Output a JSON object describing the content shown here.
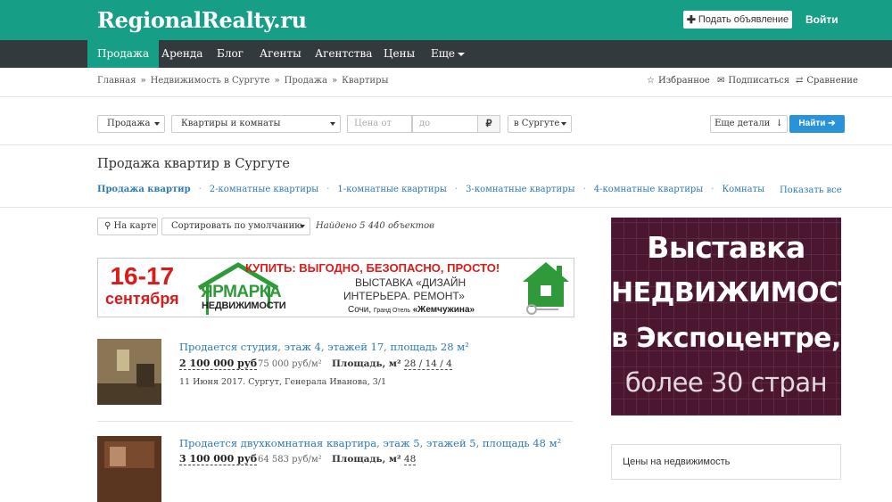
{
  "header": {
    "logo": "RegionalRealty.ru",
    "post_button": "Подать объявление",
    "login": "Войти"
  },
  "nav": {
    "items": [
      {
        "label": "Продажа",
        "active": true
      },
      {
        "label": "Аренда"
      },
      {
        "label": "Блог"
      },
      {
        "label": "Агенты"
      },
      {
        "label": "Агентства"
      },
      {
        "label": "Цены"
      },
      {
        "label": "Еще"
      }
    ]
  },
  "breadcrumbs": {
    "items": [
      "Главная",
      "Недвижимость в Сургуте",
      "Продажа",
      "Квартиры"
    ],
    "separator": "»"
  },
  "top_actions": {
    "favorites": "Избранное",
    "subscribe": "Подписаться",
    "compare": "Сравнение"
  },
  "filters": {
    "deal_type": "Продажа",
    "property_type": "Квартиры и комнаты",
    "price_from_placeholder": "Цена от",
    "price_to_placeholder": "до",
    "currency": "₽",
    "location": "в Сургуте",
    "more_details": "Еще детали",
    "search_button": "Найти"
  },
  "page": {
    "title": "Продажа квартир в Сургуте",
    "subnav": [
      "Продажа квартир",
      "2-комнатные квартиры",
      "1-комнатные квартиры",
      "3-комнатные квартиры",
      "4-комнатные квартиры",
      "Комнаты"
    ],
    "show_all": "Показать все"
  },
  "toolbar": {
    "map_button": "На карте",
    "sort": "Сортировать по умолчанию",
    "found": "Найдено 5 440 объектов"
  },
  "banner": {
    "date_line1": "16-17",
    "date_line2": "сентября",
    "fair_line1": "ЯРМАРКА",
    "fair_line2": "НЕДВИЖИМОСТИ",
    "headline": "КУПИТЬ: ВЫГОДНО,  БЕЗОПАСНО, ПРОСТО!",
    "exhibition_line1": "ВЫСТАВКА «ДИЗАЙН",
    "exhibition_line2": "ИНТЕРЬЕРА. РЕМОНТ»",
    "place_city": "Сочи,",
    "place_hotel": "Гранд Отель",
    "place_name": "«Жемчужина»"
  },
  "listings": [
    {
      "title": "Продается студия, этаж 4, этажей 17, площадь 28 м²",
      "price": "2 100 000 руб",
      "price_per_m2": "75 000 руб/м²",
      "area_label": "Площадь, м²",
      "area": "28 / 14 / 4",
      "meta": "11 Июня 2017. Сургут, Генерала Иванова, 3/1"
    },
    {
      "title": "Продается двухкомнатная квартира, этаж 5, этажей 5, площадь 48 м²",
      "price": "3 100 000 руб",
      "price_per_m2": "64 583 руб/м²",
      "area_label": "Площадь, м²",
      "area": "48"
    }
  ],
  "side_banner": {
    "line1": "Выставка",
    "line2": "НЕДВИЖИМОСТИ",
    "line3": "в Экспоцентре,",
    "line4": "более 30 стран"
  },
  "prices_box": {
    "title": "Цены на недвижимость"
  },
  "colors": {
    "brand": "#179e87",
    "nav_bg": "#333a3e",
    "link": "#2b7bb9",
    "search_button": "#2893d8",
    "side_banner_bg": "#4a1630"
  }
}
